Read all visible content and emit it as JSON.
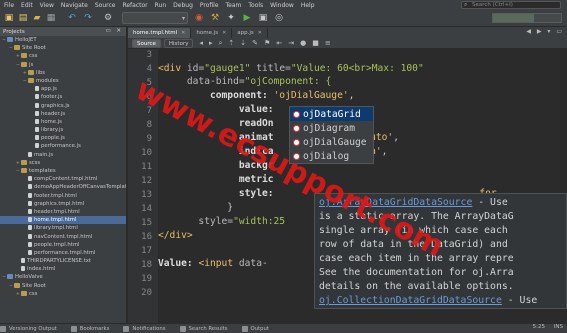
{
  "menu": [
    "File",
    "Edit",
    "View",
    "Navigate",
    "Source",
    "Refactor",
    "Run",
    "Debug",
    "Profile",
    "Team",
    "Tools",
    "Window",
    "Help"
  ],
  "search": {
    "placeholder": "Search (Ctrl+I)"
  },
  "projects": {
    "title": "Projects",
    "tree": [
      {
        "label": "HelloJET",
        "depth": 0,
        "kind": "proj",
        "toggle": "−"
      },
      {
        "label": "Site Root",
        "depth": 1,
        "kind": "folder",
        "toggle": "−"
      },
      {
        "label": "css",
        "depth": 2,
        "kind": "folder",
        "toggle": "+"
      },
      {
        "label": "js",
        "depth": 2,
        "kind": "folder",
        "toggle": "−"
      },
      {
        "label": "libs",
        "depth": 3,
        "kind": "folder",
        "toggle": "+"
      },
      {
        "label": "modules",
        "depth": 3,
        "kind": "folder",
        "toggle": "−"
      },
      {
        "label": "app.js",
        "depth": 4,
        "kind": "file",
        "toggle": ""
      },
      {
        "label": "footer.js",
        "depth": 4,
        "kind": "file",
        "toggle": ""
      },
      {
        "label": "graphics.js",
        "depth": 4,
        "kind": "file",
        "toggle": ""
      },
      {
        "label": "header.js",
        "depth": 4,
        "kind": "file",
        "toggle": ""
      },
      {
        "label": "home.js",
        "depth": 4,
        "kind": "file",
        "toggle": ""
      },
      {
        "label": "library.js",
        "depth": 4,
        "kind": "file",
        "toggle": ""
      },
      {
        "label": "people.js",
        "depth": 4,
        "kind": "file",
        "toggle": ""
      },
      {
        "label": "performance.js",
        "depth": 4,
        "kind": "file",
        "toggle": ""
      },
      {
        "label": "main.js",
        "depth": 3,
        "kind": "file",
        "toggle": ""
      },
      {
        "label": "scss",
        "depth": 2,
        "kind": "folder",
        "toggle": "+"
      },
      {
        "label": "templates",
        "depth": 2,
        "kind": "folder",
        "toggle": "−"
      },
      {
        "label": "compContent.tmpl.html",
        "depth": 3,
        "kind": "file",
        "toggle": ""
      },
      {
        "label": "demoAppHeaderOffCanvasTemplate.tmpl.html",
        "depth": 3,
        "kind": "file",
        "toggle": ""
      },
      {
        "label": "footer.tmpl.html",
        "depth": 3,
        "kind": "file",
        "toggle": ""
      },
      {
        "label": "graphics.tmpl.html",
        "depth": 3,
        "kind": "file",
        "toggle": ""
      },
      {
        "label": "header.tmpl.html",
        "depth": 3,
        "kind": "file",
        "toggle": ""
      },
      {
        "label": "home.tmpl.html",
        "depth": 3,
        "kind": "file",
        "toggle": "",
        "selected": true
      },
      {
        "label": "library.tmpl.html",
        "depth": 3,
        "kind": "file",
        "toggle": ""
      },
      {
        "label": "navContent.tmpl.html",
        "depth": 3,
        "kind": "file",
        "toggle": ""
      },
      {
        "label": "people.tmpl.html",
        "depth": 3,
        "kind": "file",
        "toggle": ""
      },
      {
        "label": "performance.tmpl.html",
        "depth": 3,
        "kind": "file",
        "toggle": ""
      },
      {
        "label": "THIRDPARTYLICENSE.txt",
        "depth": 2,
        "kind": "file",
        "toggle": ""
      },
      {
        "label": "index.html",
        "depth": 2,
        "kind": "file",
        "toggle": ""
      },
      {
        "label": "HelloValve",
        "depth": 0,
        "kind": "proj",
        "toggle": "−"
      },
      {
        "label": "Site Root",
        "depth": 1,
        "kind": "folder",
        "toggle": "−"
      },
      {
        "label": "css",
        "depth": 2,
        "kind": "folder",
        "toggle": "+"
      }
    ]
  },
  "editor": {
    "tabs": [
      {
        "label": "home.tmpl.html",
        "active": true
      },
      {
        "label": "home.js",
        "active": false
      },
      {
        "label": "app.js",
        "active": false
      }
    ],
    "source_label": "Source",
    "history_label": "History",
    "line_numbers": [
      "3",
      "4",
      "5",
      "6",
      "7",
      "8",
      "9",
      "10",
      "11",
      "12",
      "13",
      "14",
      "15",
      "16",
      "17",
      "18",
      "19",
      "20"
    ],
    "code": {
      "l4a": "<div ",
      "l4b": "id=",
      "l4c": "\"gauge1\"",
      "l4d": " title=",
      "l4e": "\"Value: 60<br>Max: 100\"",
      "l5a": "     data-bind=",
      "l5b": "\"ojComponent: {",
      "l6a": "         component: ",
      "l6b": "'ojDialGauge'",
      "l6c": ",",
      "l7a": "              value: ",
      "l8a": "              readOn",
      "l9a": "              animat",
      "l9b": "'auto'",
      "l9c": ",",
      "l10a": "              indica",
      "l10b": "lta'",
      "l10c": ",",
      "l11a": "              backgr",
      "l12a": "              metric",
      "l13a": "              style: ",
      "l13b": "for",
      "l14a": "            }",
      "l15a": "       style=",
      "l15b": "\"width:25",
      "l16a": "</div>",
      "l18a": "Value: ",
      "l18b": "<input ",
      "l18c": "data-"
    }
  },
  "completion": {
    "items": [
      "ojDataGrid",
      "ojDiagram",
      "ojDialGauge",
      "ojDialog"
    ],
    "selected_index": 0
  },
  "doc": {
    "lines": [
      {
        "link": "oj.ArrayDataGridDataSource",
        "text": " - Use"
      },
      {
        "link": "",
        "text": "is a static array. The ArrayDataG"
      },
      {
        "link": "",
        "text": "single array (in which case each"
      },
      {
        "link": "",
        "text": "row of data in the DataGrid) and"
      },
      {
        "link": "",
        "text": "case each item in the array repre"
      },
      {
        "link": "",
        "text": "See the documentation for oj.Arra"
      },
      {
        "link": "",
        "text": "details on the available options."
      },
      {
        "link": "oj.CollectionDataGridDataSource",
        "text": " - Use"
      }
    ]
  },
  "watermark": {
    "text": "www.ecsupport.com"
  },
  "status": {
    "items": [
      "Versioning Output",
      "Bookmarks",
      "Notifications",
      "Search Results",
      "Output"
    ],
    "position": "5:25",
    "mode": "INS"
  },
  "colors": {
    "accent": "#4a6a9a",
    "popup_selected": "#0d3a6f",
    "watermark": "#e01818"
  }
}
